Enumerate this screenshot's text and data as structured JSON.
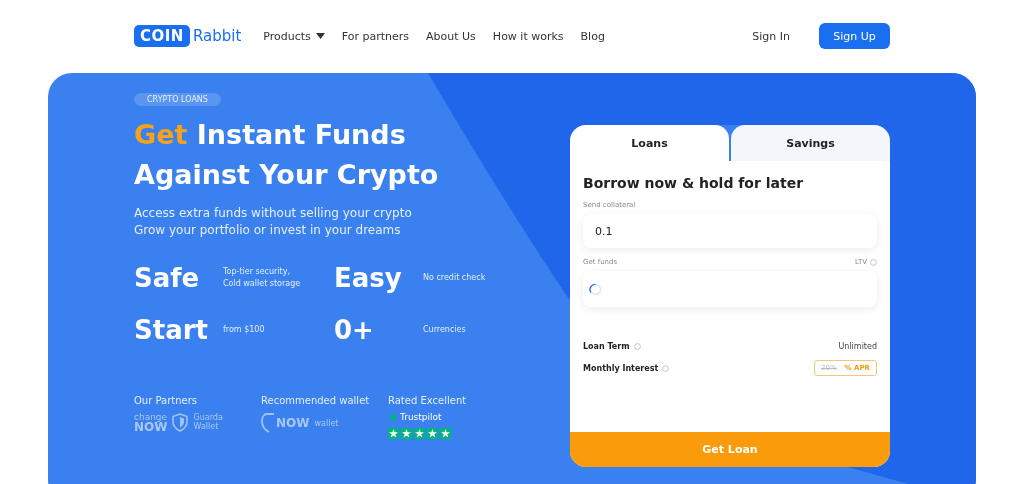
{
  "nav": {
    "logo": {
      "badge": "COIN",
      "word": "Rabbit"
    },
    "links": [
      {
        "label": "Products",
        "dropdown": true
      },
      {
        "label": "For partners",
        "dropdown": false
      },
      {
        "label": "About Us",
        "dropdown": false
      },
      {
        "label": "How it works",
        "dropdown": false
      },
      {
        "label": "Blog",
        "dropdown": false
      }
    ],
    "sign_in": "Sign In",
    "sign_up": "Sign Up"
  },
  "hero": {
    "tag": "CRYPTO LOANS",
    "heading": "**Get** Instant Funds Against Your Crypto",
    "subtitle": [
      "Access extra funds without selling your crypto",
      "Grow your portfolio or invest in your dreams"
    ],
    "features": [
      {
        "value": "Safe",
        "desc": "Top-tier security,\nCold wallet storage"
      },
      {
        "value": "Easy",
        "desc": "No credit check"
      },
      {
        "value": "Start",
        "desc": "from $100"
      },
      {
        "value": "0+",
        "desc": "Currencies"
      }
    ],
    "partners": {
      "title": "Our Partners",
      "change": "change",
      "now": "NOW",
      "guarda": "Guarda",
      "guarda_sub": "Wallet"
    },
    "wallet": {
      "title": "Recommended wallet",
      "now": "NOW",
      "word": "wallet"
    },
    "rating": {
      "title": "Rated Excellent",
      "brand": "Trustpilot",
      "stars": 5
    }
  },
  "card": {
    "tabs": [
      {
        "label": "Loans",
        "selected": true
      },
      {
        "label": "Savings",
        "selected": false
      }
    ],
    "title": "Borrow now & hold for later",
    "collateral": {
      "label": "Send collateral",
      "value": "0.1"
    },
    "funds": {
      "label": "Get funds",
      "ltv": "LTV",
      "loading": true
    },
    "loan_term": {
      "label": "Loan Term",
      "value": "Unlimited"
    },
    "interest": {
      "label": "Monthly Interest",
      "old": "20%",
      "apr": "% APR"
    },
    "button": "Get Loan"
  }
}
